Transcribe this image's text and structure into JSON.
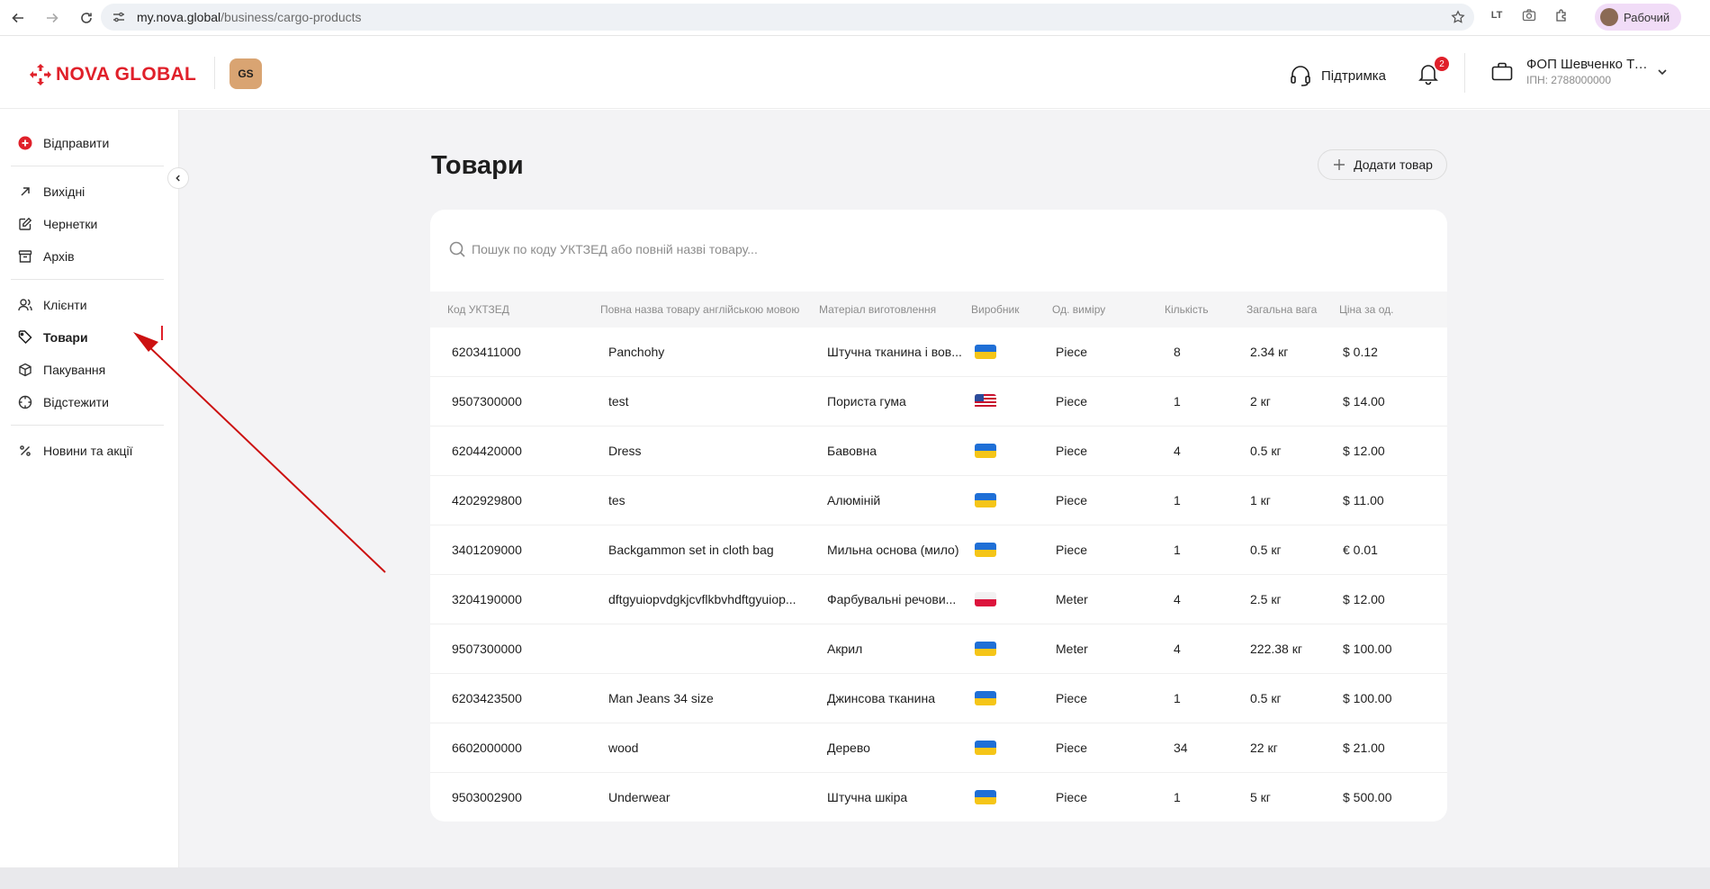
{
  "browser": {
    "url_host": "my.nova.global",
    "url_path": "/business/cargo-products",
    "ext_label": "LT",
    "profile_label": "Рабочий"
  },
  "header": {
    "logo_text": "NOVA GLOBAL",
    "badge_text": "GS",
    "support_label": "Підтримка",
    "notifications_count": "2",
    "account_name": "ФОП Шевченко Та...",
    "account_inn": "ІПН: 2788000000"
  },
  "sidebar": {
    "send_label": "Відправити",
    "items": [
      {
        "label": "Вихідні",
        "icon": "arrow-up-right-icon"
      },
      {
        "label": "Чернетки",
        "icon": "edit-icon"
      },
      {
        "label": "Архів",
        "icon": "archive-icon"
      },
      {
        "label": "Клієнти",
        "icon": "users-icon"
      },
      {
        "label": "Товари",
        "icon": "tag-icon"
      },
      {
        "label": "Пакування",
        "icon": "box-icon"
      },
      {
        "label": "Відстежити",
        "icon": "track-icon"
      },
      {
        "label": "Новини та акції",
        "icon": "percent-icon"
      }
    ],
    "active_item": "Товари"
  },
  "main": {
    "title": "Товари",
    "add_button_label": "Додати товар",
    "search_placeholder": "Пошук по коду УКТЗЕД або повній назві товару...",
    "columns": [
      "Код УКТЗЕД",
      "Повна назва товару англійською мовою",
      "Матеріал виготовлення",
      "Виробник",
      "Од. виміру",
      "Кількість",
      "Загальна вага",
      "Ціна за од."
    ],
    "rows": [
      {
        "code": "6203411000",
        "name": "Panchohy",
        "material": "Штучна тканина і вов...",
        "flag": "ua",
        "unit": "Piece",
        "qty": "8",
        "weight": "2.34 кг",
        "price": "$ 0.12"
      },
      {
        "code": "9507300000",
        "name": "test",
        "material": "Пориста гума",
        "flag": "us",
        "unit": "Piece",
        "qty": "1",
        "weight": "2 кг",
        "price": "$ 14.00"
      },
      {
        "code": "6204420000",
        "name": "Dress",
        "material": "Бавовна",
        "flag": "ua",
        "unit": "Piece",
        "qty": "4",
        "weight": "0.5 кг",
        "price": "$ 12.00"
      },
      {
        "code": "4202929800",
        "name": "tes",
        "material": "Алюміній",
        "flag": "ua",
        "unit": "Piece",
        "qty": "1",
        "weight": "1 кг",
        "price": "$ 11.00"
      },
      {
        "code": "3401209000",
        "name": "Backgammon set in cloth bag",
        "material": "Мильна основа (мило)",
        "flag": "ua",
        "unit": "Piece",
        "qty": "1",
        "weight": "0.5 кг",
        "price": "€ 0.01"
      },
      {
        "code": "3204190000",
        "name": "dftgyuiopvdgkjcvflkbvhdftgyuiop...",
        "material": "Фарбувальні речови...",
        "flag": "pl",
        "unit": "Meter",
        "qty": "4",
        "weight": "2.5 кг",
        "price": "$ 12.00"
      },
      {
        "code": "9507300000",
        "name": "",
        "material": "Акрил",
        "flag": "ua",
        "unit": "Meter",
        "qty": "4",
        "weight": "222.38 кг",
        "price": "$ 100.00"
      },
      {
        "code": "6203423500",
        "name": "Man Jeans 34 size",
        "material": "Джинсова тканина",
        "flag": "ua",
        "unit": "Piece",
        "qty": "1",
        "weight": "0.5 кг",
        "price": "$ 100.00"
      },
      {
        "code": "6602000000",
        "name": "wood",
        "material": "Дерево",
        "flag": "ua",
        "unit": "Piece",
        "qty": "34",
        "weight": "22 кг",
        "price": "$ 21.00"
      },
      {
        "code": "9503002900",
        "name": "Underwear",
        "material": "Штучна шкіра",
        "flag": "ua",
        "unit": "Piece",
        "qty": "1",
        "weight": "5 кг",
        "price": "$ 500.00"
      }
    ]
  },
  "colors": {
    "brand_red": "#e0202a",
    "background": "#f3f3f5",
    "annotation_arrow": "#cc1111"
  }
}
